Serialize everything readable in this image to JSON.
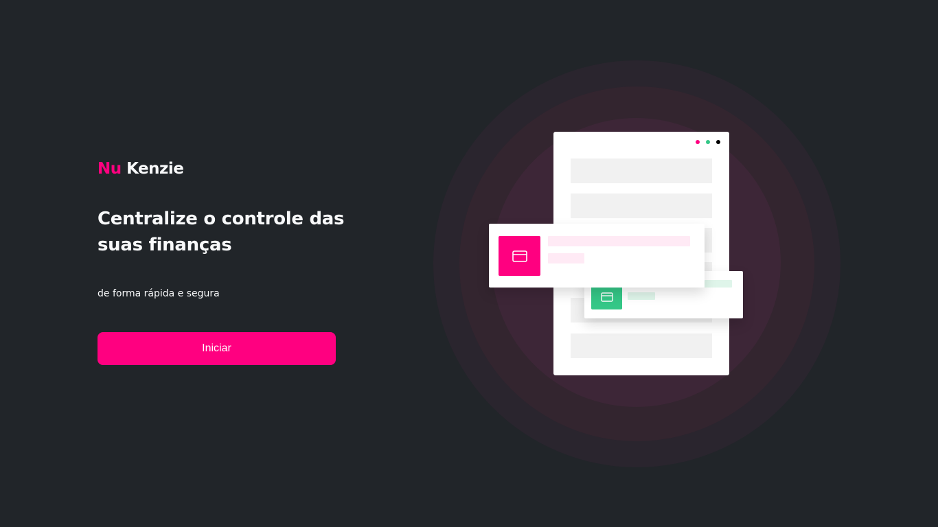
{
  "brand": {
    "accent": "Nu",
    "name": "Kenzie"
  },
  "hero": {
    "headline": "Centralize o controle das suas finanças",
    "subtitle": "de forma rápida e segura",
    "start_label": "Iniciar"
  },
  "colors": {
    "background": "#212529",
    "primary": "#ff0080",
    "success": "#34c787",
    "text": "#f8f9fa"
  },
  "illustration": {
    "card_icon": "credit-card-icon",
    "window_dots": [
      "pink",
      "green",
      "black"
    ]
  }
}
